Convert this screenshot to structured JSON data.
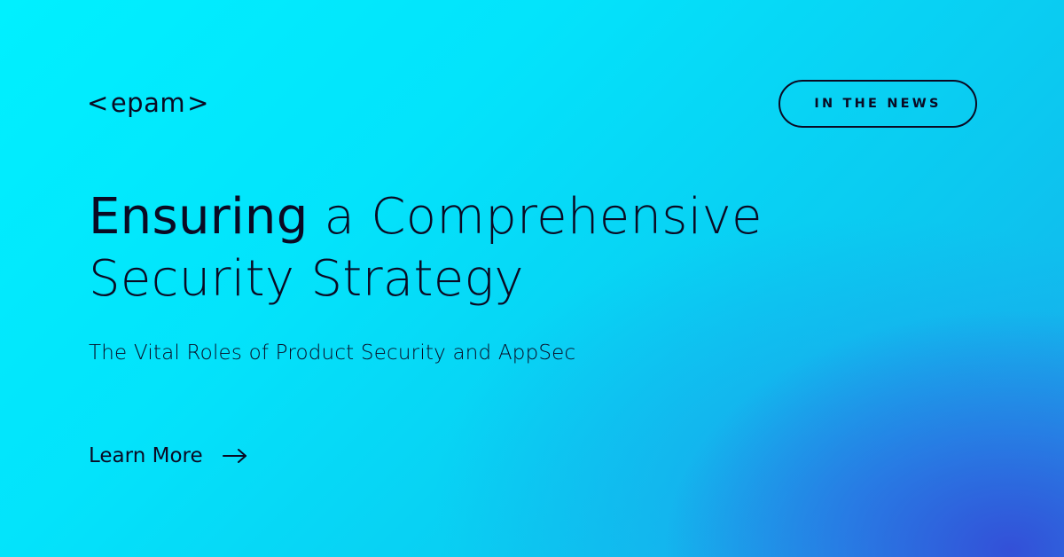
{
  "brand": {
    "logo_text": "epam",
    "logo_open": "<",
    "logo_close": ">"
  },
  "badge": {
    "label": "IN THE NEWS"
  },
  "headline": {
    "line1_bold": "Ensuring",
    "line1_rest": " a Comprehensive",
    "line2": "Security Strategy"
  },
  "subtitle": "The Vital Roles of Product Security and AppSec",
  "cta": {
    "label": "Learn More",
    "icon": "arrow-right-icon"
  },
  "colors": {
    "background_start": "#00f0ff",
    "background_end": "#3350d8",
    "text": "#0a0a23"
  }
}
